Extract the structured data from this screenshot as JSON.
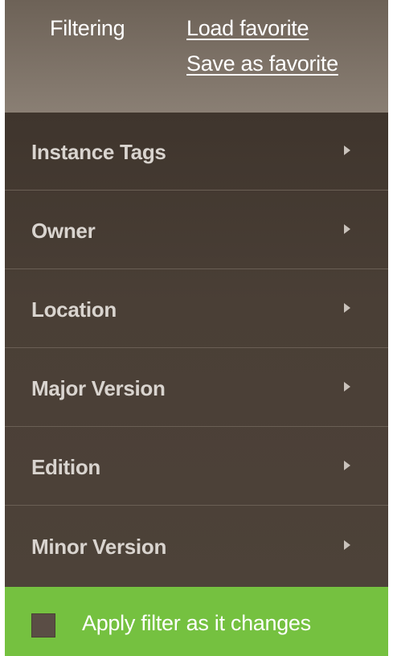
{
  "header": {
    "title": "Filtering",
    "load_favorite": "Load favorite",
    "save_favorite": "Save as favorite"
  },
  "filters": [
    {
      "label": "Instance Tags",
      "icon": "triangle-right-icon"
    },
    {
      "label": "Owner",
      "icon": "triangle-right-icon"
    },
    {
      "label": "Location",
      "icon": "triangle-right-icon"
    },
    {
      "label": "Major Version",
      "icon": "triangle-right-icon"
    },
    {
      "label": "Edition",
      "icon": "triangle-right-icon"
    },
    {
      "label": "Minor Version",
      "icon": "triangle-right-icon"
    }
  ],
  "footer": {
    "apply_label": "Apply filter as it changes",
    "checked": false
  },
  "colors": {
    "panel": "#4a3f36",
    "header": "#7e7368",
    "footer_green": "#75c140",
    "filter_text": "#d9d4cf"
  }
}
